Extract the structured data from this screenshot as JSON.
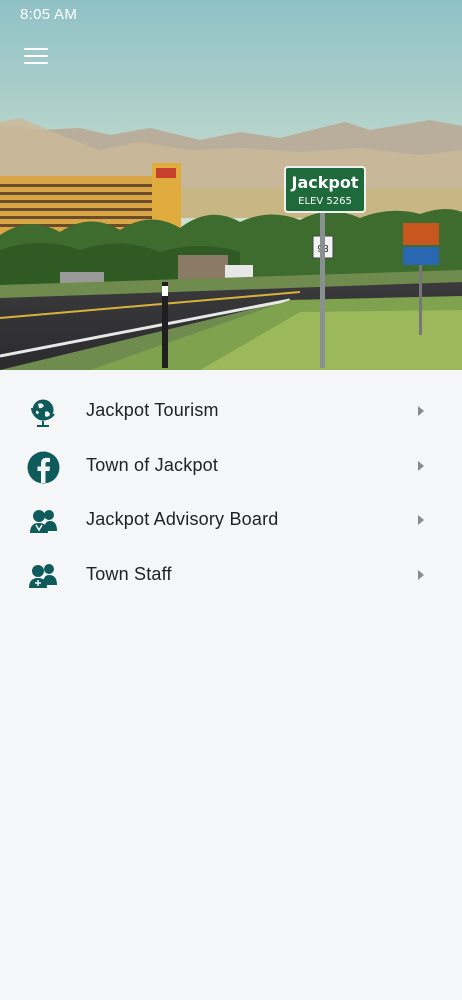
{
  "status_bar": {
    "time": "8:05 AM"
  },
  "header": {
    "menu_icon": "hamburger-icon"
  },
  "hero": {
    "sign_title": "Jackpot",
    "sign_subtitle": "ELEV 5265",
    "route_number": "93"
  },
  "menu": {
    "items": [
      {
        "label": "Jackpot Tourism",
        "icon": "globe-icon"
      },
      {
        "label": "Town of Jackpot",
        "icon": "facebook-icon"
      },
      {
        "label": "Jackpot Advisory Board",
        "icon": "group-icon"
      },
      {
        "label": "Town Staff",
        "icon": "staff-icon"
      }
    ]
  },
  "colors": {
    "icon": "#0f5a5a",
    "chevron": "#8a8a8a",
    "background": "#f5f6f8"
  }
}
